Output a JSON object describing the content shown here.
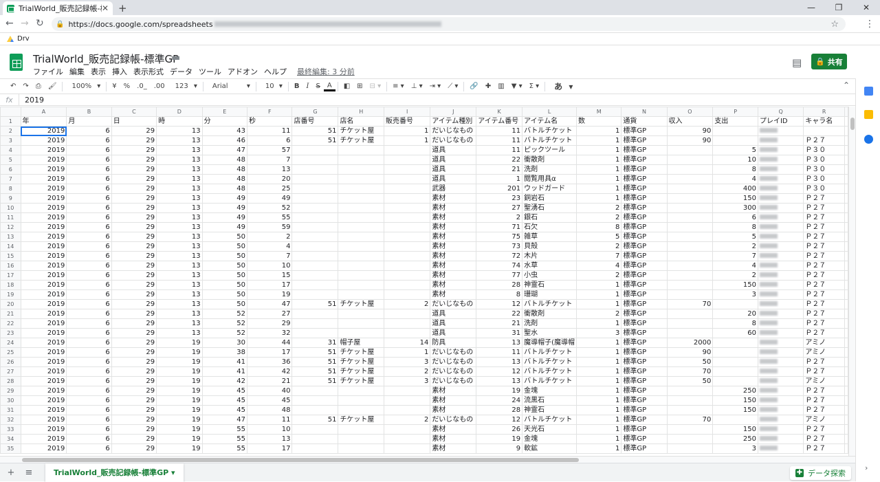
{
  "browser": {
    "tab_title": "TrialWorld_販売記録帳-標準GP",
    "url": "https://docs.google.com/spreadsheets",
    "bookmark": "Drv"
  },
  "doc": {
    "title": "TrialWorld_販売記録帳-標準GP",
    "menu": [
      "ファイル",
      "編集",
      "表示",
      "挿入",
      "表示形式",
      "データ",
      "ツール",
      "アドオン",
      "ヘルプ"
    ],
    "last_edit": "最終編集: 3 分前",
    "share": "共有"
  },
  "toolbar": {
    "zoom": "100%",
    "currency": "¥",
    "percent": "%",
    "dec_less": ".0_",
    "dec_more": ".00",
    "numfmt": "123",
    "font": "Arial",
    "size": "10",
    "bold": "B",
    "italic": "I",
    "strike": "S",
    "textcolor": "A",
    "ime": "あ"
  },
  "formula": {
    "fx": "fx",
    "value": "2019"
  },
  "columns": [
    "A",
    "B",
    "C",
    "D",
    "E",
    "F",
    "G",
    "H",
    "I",
    "J",
    "K",
    "L",
    "M",
    "N",
    "O",
    "P",
    "Q",
    "R"
  ],
  "header_row": [
    "年",
    "月",
    "日",
    "時",
    "分",
    "秒",
    "店番号",
    "店名",
    "販売番号",
    "アイテム種別",
    "アイテム番号",
    "アイテム名",
    "数",
    "通貨",
    "収入",
    "支出",
    "プレイID",
    "キャラ名"
  ],
  "rows": [
    [
      "2019",
      "6",
      "29",
      "13",
      "43",
      "11",
      "51",
      "チケット屋",
      "1",
      "だいじなもの",
      "11",
      "バトルチケット",
      "1",
      "標準GP",
      "90",
      "",
      "",
      ""
    ],
    [
      "2019",
      "6",
      "29",
      "13",
      "46",
      "6",
      "51",
      "チケット屋",
      "1",
      "だいじなもの",
      "11",
      "バトルチケット",
      "1",
      "標準GP",
      "90",
      "",
      "",
      "Ｐ２７"
    ],
    [
      "2019",
      "6",
      "29",
      "13",
      "47",
      "57",
      "",
      "",
      "",
      "道具",
      "11",
      "ピックツール",
      "1",
      "標準GP",
      "",
      "5",
      "",
      "Ｐ３０"
    ],
    [
      "2019",
      "6",
      "29",
      "13",
      "48",
      "7",
      "",
      "",
      "",
      "道具",
      "22",
      "衝散剤",
      "1",
      "標準GP",
      "",
      "10",
      "",
      "Ｐ３０"
    ],
    [
      "2019",
      "6",
      "29",
      "13",
      "48",
      "13",
      "",
      "",
      "",
      "道具",
      "21",
      "洗剤",
      "1",
      "標準GP",
      "",
      "8",
      "",
      "Ｐ３０"
    ],
    [
      "2019",
      "6",
      "29",
      "13",
      "48",
      "20",
      "",
      "",
      "",
      "道具",
      "1",
      "閲覧用具α",
      "1",
      "標準GP",
      "",
      "4",
      "",
      "Ｐ３０"
    ],
    [
      "2019",
      "6",
      "29",
      "13",
      "48",
      "25",
      "",
      "",
      "",
      "武器",
      "201",
      "ウッドガード",
      "1",
      "標準GP",
      "",
      "400",
      "",
      "Ｐ３０"
    ],
    [
      "2019",
      "6",
      "29",
      "13",
      "49",
      "49",
      "",
      "",
      "",
      "素材",
      "23",
      "銅岩石",
      "1",
      "標準GP",
      "",
      "150",
      "",
      "Ｐ２７"
    ],
    [
      "2019",
      "6",
      "29",
      "13",
      "49",
      "52",
      "",
      "",
      "",
      "素材",
      "27",
      "聖湧石",
      "2",
      "標準GP",
      "",
      "300",
      "",
      "Ｐ２７"
    ],
    [
      "2019",
      "6",
      "29",
      "13",
      "49",
      "55",
      "",
      "",
      "",
      "素材",
      "2",
      "銀石",
      "2",
      "標準GP",
      "",
      "6",
      "",
      "Ｐ２７"
    ],
    [
      "2019",
      "6",
      "29",
      "13",
      "49",
      "59",
      "",
      "",
      "",
      "素材",
      "71",
      "石欠",
      "8",
      "標準GP",
      "",
      "8",
      "",
      "Ｐ２７"
    ],
    [
      "2019",
      "6",
      "29",
      "13",
      "50",
      "2",
      "",
      "",
      "",
      "素材",
      "75",
      "雑草",
      "5",
      "標準GP",
      "",
      "5",
      "",
      "Ｐ２７"
    ],
    [
      "2019",
      "6",
      "29",
      "13",
      "50",
      "4",
      "",
      "",
      "",
      "素材",
      "73",
      "貝殻",
      "2",
      "標準GP",
      "",
      "2",
      "",
      "Ｐ２７"
    ],
    [
      "2019",
      "6",
      "29",
      "13",
      "50",
      "7",
      "",
      "",
      "",
      "素材",
      "72",
      "木片",
      "7",
      "標準GP",
      "",
      "7",
      "",
      "Ｐ２７"
    ],
    [
      "2019",
      "6",
      "29",
      "13",
      "50",
      "10",
      "",
      "",
      "",
      "素材",
      "74",
      "水草",
      "4",
      "標準GP",
      "",
      "4",
      "",
      "Ｐ２７"
    ],
    [
      "2019",
      "6",
      "29",
      "13",
      "50",
      "15",
      "",
      "",
      "",
      "素材",
      "77",
      "小虫",
      "2",
      "標準GP",
      "",
      "2",
      "",
      "Ｐ２７"
    ],
    [
      "2019",
      "6",
      "29",
      "13",
      "50",
      "17",
      "",
      "",
      "",
      "素材",
      "28",
      "神霊石",
      "1",
      "標準GP",
      "",
      "150",
      "",
      "Ｐ２７"
    ],
    [
      "2019",
      "6",
      "29",
      "13",
      "50",
      "19",
      "",
      "",
      "",
      "素材",
      "8",
      "珊瑚",
      "1",
      "標準GP",
      "",
      "3",
      "",
      "Ｐ２７"
    ],
    [
      "2019",
      "6",
      "29",
      "13",
      "50",
      "47",
      "51",
      "チケット屋",
      "2",
      "だいじなもの",
      "12",
      "バトルチケット",
      "1",
      "標準GP",
      "70",
      "",
      "",
      "Ｐ２７"
    ],
    [
      "2019",
      "6",
      "29",
      "13",
      "52",
      "27",
      "",
      "",
      "",
      "道具",
      "22",
      "衝散剤",
      "2",
      "標準GP",
      "",
      "20",
      "",
      "Ｐ２７"
    ],
    [
      "2019",
      "6",
      "29",
      "13",
      "52",
      "29",
      "",
      "",
      "",
      "道具",
      "21",
      "洗剤",
      "1",
      "標準GP",
      "",
      "8",
      "",
      "Ｐ２７"
    ],
    [
      "2019",
      "6",
      "29",
      "13",
      "52",
      "32",
      "",
      "",
      "",
      "道具",
      "31",
      "聖水",
      "3",
      "標準GP",
      "",
      "60",
      "",
      "Ｐ２７"
    ],
    [
      "2019",
      "6",
      "29",
      "19",
      "30",
      "44",
      "31",
      "帽子屋",
      "14",
      "防具",
      "13",
      "魔導帽子(魔導帽",
      "1",
      "標準GP",
      "2000",
      "",
      "",
      "アミノ"
    ],
    [
      "2019",
      "6",
      "29",
      "19",
      "38",
      "17",
      "51",
      "チケット屋",
      "1",
      "だいじなもの",
      "11",
      "バトルチケット",
      "1",
      "標準GP",
      "90",
      "",
      "",
      "アミノ"
    ],
    [
      "2019",
      "6",
      "29",
      "19",
      "41",
      "36",
      "51",
      "チケット屋",
      "3",
      "だいじなもの",
      "13",
      "バトルチケット",
      "1",
      "標準GP",
      "50",
      "",
      "",
      "Ｐ２７"
    ],
    [
      "2019",
      "6",
      "29",
      "19",
      "41",
      "42",
      "51",
      "チケット屋",
      "2",
      "だいじなもの",
      "12",
      "バトルチケット",
      "1",
      "標準GP",
      "70",
      "",
      "",
      "Ｐ２７"
    ],
    [
      "2019",
      "6",
      "29",
      "19",
      "42",
      "21",
      "51",
      "チケット屋",
      "3",
      "だいじなもの",
      "13",
      "バトルチケット",
      "1",
      "標準GP",
      "50",
      "",
      "",
      "アミノ"
    ],
    [
      "2019",
      "6",
      "29",
      "19",
      "45",
      "40",
      "",
      "",
      "",
      "素材",
      "19",
      "金塊",
      "1",
      "標準GP",
      "",
      "250",
      "",
      "Ｐ２７"
    ],
    [
      "2019",
      "6",
      "29",
      "19",
      "45",
      "45",
      "",
      "",
      "",
      "素材",
      "24",
      "流黒石",
      "1",
      "標準GP",
      "",
      "150",
      "",
      "Ｐ２７"
    ],
    [
      "2019",
      "6",
      "29",
      "19",
      "45",
      "48",
      "",
      "",
      "",
      "素材",
      "28",
      "神霊石",
      "1",
      "標準GP",
      "",
      "150",
      "",
      "Ｐ２７"
    ],
    [
      "2019",
      "6",
      "29",
      "19",
      "47",
      "11",
      "51",
      "チケット屋",
      "2",
      "だいじなもの",
      "12",
      "バトルチケット",
      "1",
      "標準GP",
      "70",
      "",
      "",
      "アミノ"
    ],
    [
      "2019",
      "6",
      "29",
      "19",
      "55",
      "10",
      "",
      "",
      "",
      "素材",
      "26",
      "天光石",
      "1",
      "標準GP",
      "",
      "150",
      "",
      "Ｐ２７"
    ],
    [
      "2019",
      "6",
      "29",
      "19",
      "55",
      "13",
      "",
      "",
      "",
      "素材",
      "19",
      "金塊",
      "1",
      "標準GP",
      "",
      "250",
      "",
      "Ｐ２７"
    ],
    [
      "2019",
      "6",
      "29",
      "19",
      "55",
      "17",
      "",
      "",
      "",
      "素材",
      "9",
      "軟鉱",
      "1",
      "標準GP",
      "",
      "3",
      "",
      "Ｐ２７"
    ]
  ],
  "sheet_tab": "TrialWorld_販売記録帳-標準GP",
  "explore": "データ探索",
  "colors": {
    "accent": "#188038",
    "selection": "#1a73e8"
  }
}
